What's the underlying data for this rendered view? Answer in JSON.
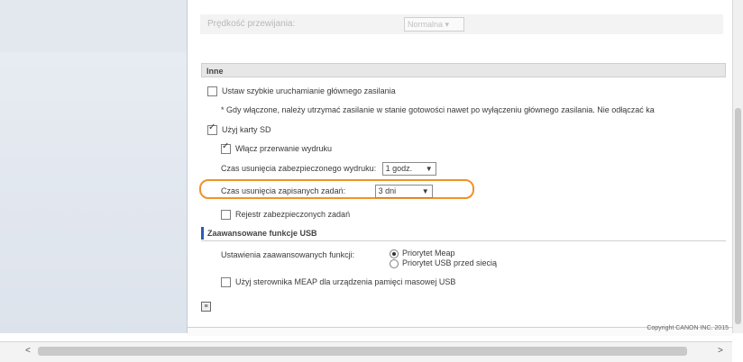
{
  "faded": {
    "speed_label": "Prędkość przewijania:",
    "speed_value": "Normalna"
  },
  "sections": {
    "inne": "Inne",
    "usb": "Zaawansowane funkcje USB"
  },
  "inne": {
    "quick_start": "Ustaw szybkie uruchamianie głównego zasilania",
    "quick_start_note": "* Gdy włączone, należy utrzymać zasilanie w stanie gotowości nawet po wyłączeniu głównego zasilania. Nie odłączać ka",
    "use_sd": "Użyj karty SD",
    "print_hold": "Włącz przerwanie wydruku",
    "secure_print_delete_label": "Czas usunięcia zabezpieczonego wydruku:",
    "secure_print_delete_value": "1 godz.",
    "saved_jobs_delete_label": "Czas usunięcia zapisanych zadań:",
    "saved_jobs_delete_value": "3 dni",
    "secure_jobs_log": "Rejestr zabezpieczonych zadań"
  },
  "usb": {
    "advanced_label": "Ustawienia zaawansowanych funkcji:",
    "option_meap": "Priorytet Meap",
    "option_usb": "Priorytet USB przed siecią",
    "meap_driver": "Użyj sterownika MEAP dla urządzenia pamięci masowej USB"
  },
  "footer": {
    "copyright": "Copyright CANON INC. 2015"
  },
  "scroll": {
    "left": "<",
    "right": ">"
  }
}
